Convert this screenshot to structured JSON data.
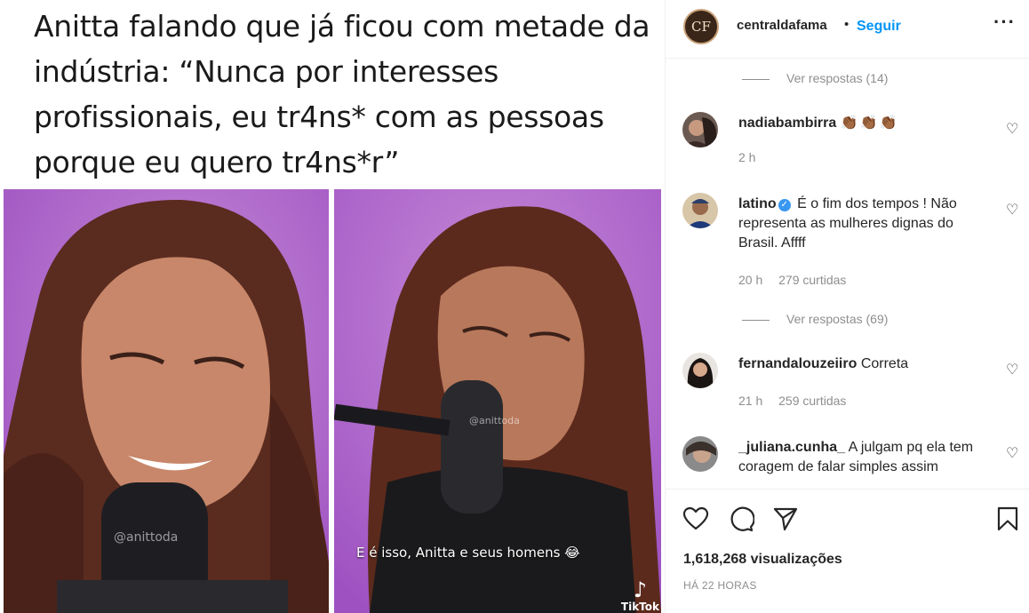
{
  "post": {
    "tweet_text": "Anitta falando que já ficou com metade da indústria: “Nunca por interesses profissionais, eu tr4ns* com as pessoas porque eu quero tr4ns*r”",
    "watermark_left": "@anittoda",
    "watermark_right": "@anittoda",
    "video_caption": "E é isso, Anitta e seus homens 😂",
    "tiktok_label": "TikTok"
  },
  "header": {
    "avatar_initials": "CF",
    "username": "centraldafama",
    "separator": "•",
    "follow_label": "Seguir",
    "more_label": "···"
  },
  "comments": {
    "view_replies_1": "Ver respostas (14)",
    "items": [
      {
        "username": "nadiabambirra",
        "text": "👏🏾👏🏾👏🏾",
        "time": "2 h",
        "likes": ""
      },
      {
        "username": "latino",
        "verified": true,
        "text": "É o fim dos tempos ! Não representa as mulheres dignas do Brasil. Affff",
        "time": "20 h",
        "likes": "279 curtidas"
      },
      {
        "username": "fernandalouzeiiro",
        "text": "Correta",
        "time": "21 h",
        "likes": "259 curtidas"
      },
      {
        "username": "_juliana.cunha_",
        "text": "A julgam pq ela tem coragem de falar simples assim",
        "time": "",
        "likes": ""
      }
    ],
    "view_replies_2": "Ver respostas (69)",
    "like_icon": "♡"
  },
  "footer": {
    "views": "1,618,268 visualizações",
    "timestamp": "HÁ 22 HORAS"
  },
  "colors": {
    "accent": "#0095f6",
    "muted": "#8e8e8e",
    "video_bg": "#b46ad0"
  }
}
